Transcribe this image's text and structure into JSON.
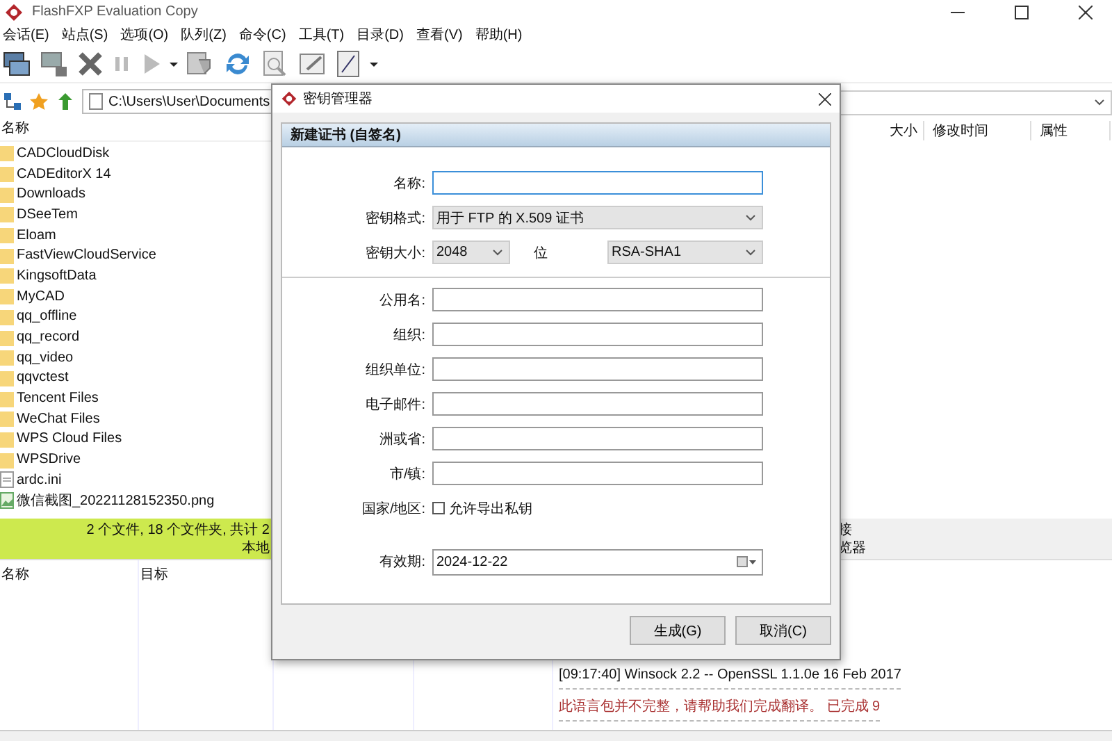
{
  "window": {
    "title": "FlashFXP Evaluation Copy"
  },
  "menu": [
    "会话(E)",
    "站点(S)",
    "选项(O)",
    "队列(Z)",
    "命令(C)",
    "工具(T)",
    "目录(D)",
    "查看(V)",
    "帮助(H)"
  ],
  "local_path": "C:\\Users\\User\\Documents",
  "local_columns": [
    "名称"
  ],
  "files": [
    {
      "name": "CADCloudDisk",
      "kind": "folder"
    },
    {
      "name": "CADEditorX 14",
      "kind": "folder"
    },
    {
      "name": "Downloads",
      "kind": "folder"
    },
    {
      "name": "DSeeTem",
      "kind": "folder"
    },
    {
      "name": "Eloam",
      "kind": "folder"
    },
    {
      "name": "FastViewCloudService",
      "kind": "folder"
    },
    {
      "name": "KingsoftData",
      "kind": "folder"
    },
    {
      "name": "MyCAD",
      "kind": "folder"
    },
    {
      "name": "qq_offline",
      "kind": "folder"
    },
    {
      "name": "qq_record",
      "kind": "folder"
    },
    {
      "name": "qq_video",
      "kind": "folder"
    },
    {
      "name": "qqvctest",
      "kind": "folder"
    },
    {
      "name": "Tencent Files",
      "kind": "folder"
    },
    {
      "name": "WeChat Files",
      "kind": "folder"
    },
    {
      "name": "WPS Cloud Files",
      "kind": "folder"
    },
    {
      "name": "WPSDrive",
      "kind": "folder"
    },
    {
      "name": "ardc.ini",
      "kind": "file"
    },
    {
      "name": "微信截图_20221128152350.png",
      "kind": "image"
    }
  ],
  "local_status": [
    "2 个文件, 18 个文件夹, 共计 2",
    "本地"
  ],
  "remote_columns": [
    "大小",
    "修改时间",
    "属性"
  ],
  "remote_status": [
    "接",
    "览器"
  ],
  "queue_columns": [
    "名称",
    "目标"
  ],
  "log": [
    {
      "text": "[09:17:40]  Winsock 2.2 -- OpenSSL 1.1.0e  16 Feb 2017",
      "kind": "info"
    },
    {
      "text": "此语言包并不完整，请帮助我们完成翻译。 已完成 9",
      "kind": "warning"
    }
  ],
  "dialog": {
    "title": "密钥管理器",
    "section": "新建证书 (自签名)",
    "fields": [
      {
        "kind": "text",
        "label": "名称:",
        "focused": true
      },
      {
        "kind": "select",
        "label": "密钥格式:",
        "value": "用于 FTP 的 X.509 证书"
      },
      {
        "kind": "size",
        "label": "密钥大小:",
        "value": "2048",
        "unit": "位",
        "algorithm": "RSA-SHA1"
      },
      {
        "kind": "divider"
      },
      {
        "kind": "text",
        "label": "公用名:",
        "focused": false
      },
      {
        "kind": "text",
        "label": "组织:",
        "focused": false
      },
      {
        "kind": "text",
        "label": "组织单位:",
        "focused": false
      },
      {
        "kind": "text",
        "label": "电子邮件:",
        "focused": false
      },
      {
        "kind": "text",
        "label": "洲或省:",
        "focused": false
      },
      {
        "kind": "text",
        "label": "市/镇:",
        "focused": false
      },
      {
        "kind": "checkbox",
        "label": "国家/地区:",
        "text": "允许导出私钥",
        "checked": false
      },
      {
        "kind": "date",
        "label": "有效期:",
        "value": "2024-12-22"
      }
    ],
    "buttons": [
      "生成(G)",
      "取消(C)"
    ]
  }
}
